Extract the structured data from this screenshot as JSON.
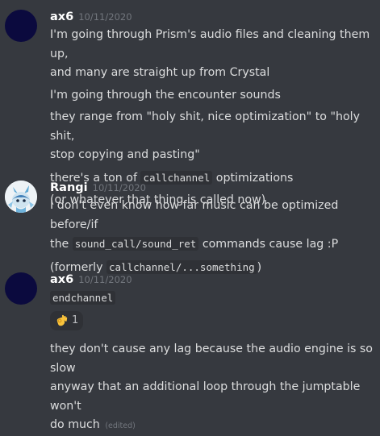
{
  "messages": [
    {
      "author": "ax6",
      "timestamp": "10/11/2020",
      "lines": [
        {
          "t1": "I'm going through Prism's audio files and cleaning them up,",
          "t2": "and many are straight up from Crystal"
        },
        {
          "t1": "I'm going through the encounter sounds"
        },
        {
          "t1": "they range from \"holy shit, nice optimization\" to \"holy shit,",
          "t2": "stop copying and pasting\""
        },
        {
          "pre": "there's a ton of ",
          "code": "callchannel",
          "post": " optimizations"
        },
        {
          "t1": "(or whatever that thing is called now)"
        }
      ]
    },
    {
      "author": "Rangi",
      "timestamp": "10/11/2020",
      "line1": "I don't even know how far music can be optimized before/if",
      "line2_pre": "the ",
      "line2_code": "sound_call/sound_ret",
      "line2_post": " commands cause lag :P",
      "line3_pre": "(formerly ",
      "line3_code": "callchannel/...something",
      "line3_post": ")"
    },
    {
      "author": "ax6",
      "timestamp": "10/11/2020",
      "code": "endchannel",
      "reaction": {
        "emoji": "ok-hand",
        "count": "1"
      },
      "text1": "they don't cause any lag because the audio engine is so slow",
      "text2": "anyway that an additional loop through the jumptable won't",
      "text3": "do much",
      "edited": "(edited)"
    }
  ]
}
